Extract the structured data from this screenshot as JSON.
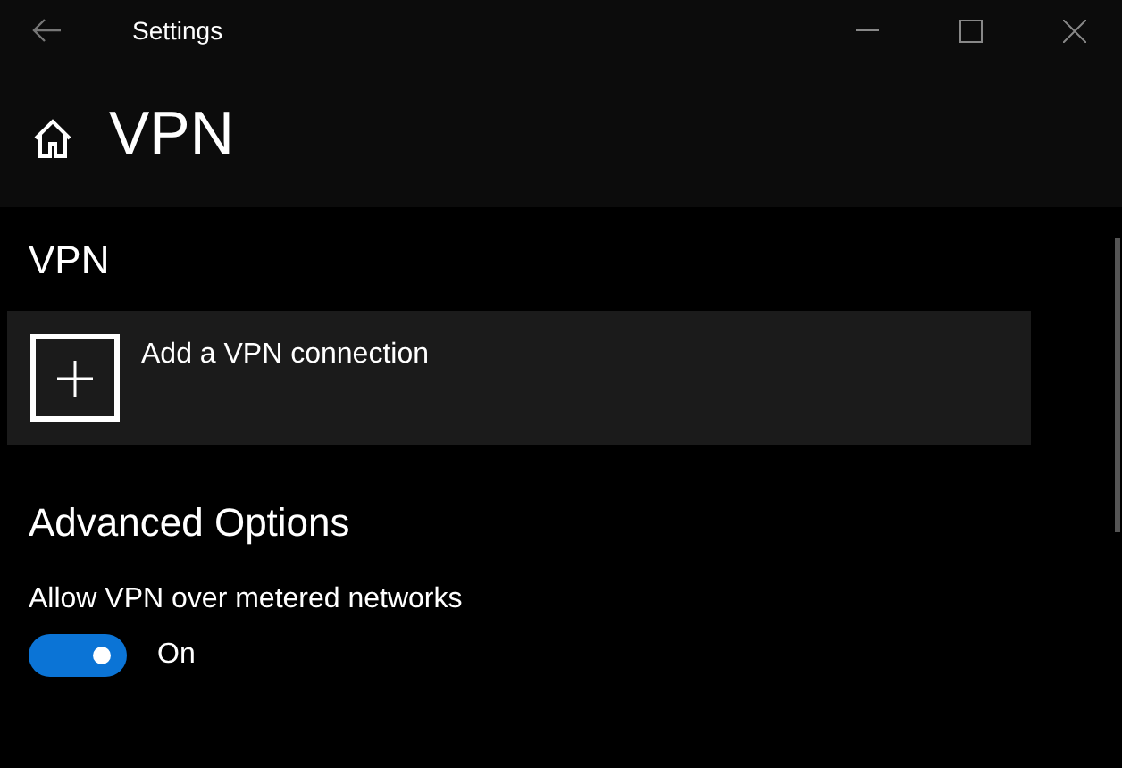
{
  "window": {
    "title": "Settings"
  },
  "page": {
    "title": "VPN"
  },
  "vpn_section": {
    "heading": "VPN",
    "add_button": {
      "label": "Add a VPN connection"
    }
  },
  "advanced": {
    "heading": "Advanced Options",
    "setting": {
      "label": "Allow VPN over metered networks",
      "on": true,
      "state_text": "On"
    }
  }
}
